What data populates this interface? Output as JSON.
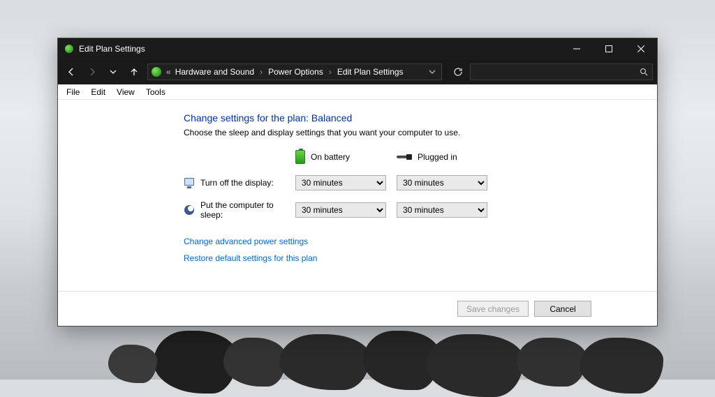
{
  "window": {
    "title": "Edit Plan Settings"
  },
  "breadcrumb": {
    "items": [
      "Hardware and Sound",
      "Power Options",
      "Edit Plan Settings"
    ]
  },
  "menu": {
    "items": [
      "File",
      "Edit",
      "View",
      "Tools"
    ]
  },
  "page": {
    "heading": "Change settings for the plan: Balanced",
    "subtext": "Choose the sleep and display settings that you want your computer to use.",
    "col_battery": "On battery",
    "col_plugged": "Plugged in",
    "rows": [
      {
        "label": "Turn off the display:",
        "battery_value": "30 minutes",
        "plugged_value": "30 minutes"
      },
      {
        "label": "Put the computer to sleep:",
        "battery_value": "30 minutes",
        "plugged_value": "30 minutes"
      }
    ],
    "link_advanced": "Change advanced power settings",
    "link_restore": "Restore default settings for this plan"
  },
  "footer": {
    "save": "Save changes",
    "cancel": "Cancel"
  }
}
